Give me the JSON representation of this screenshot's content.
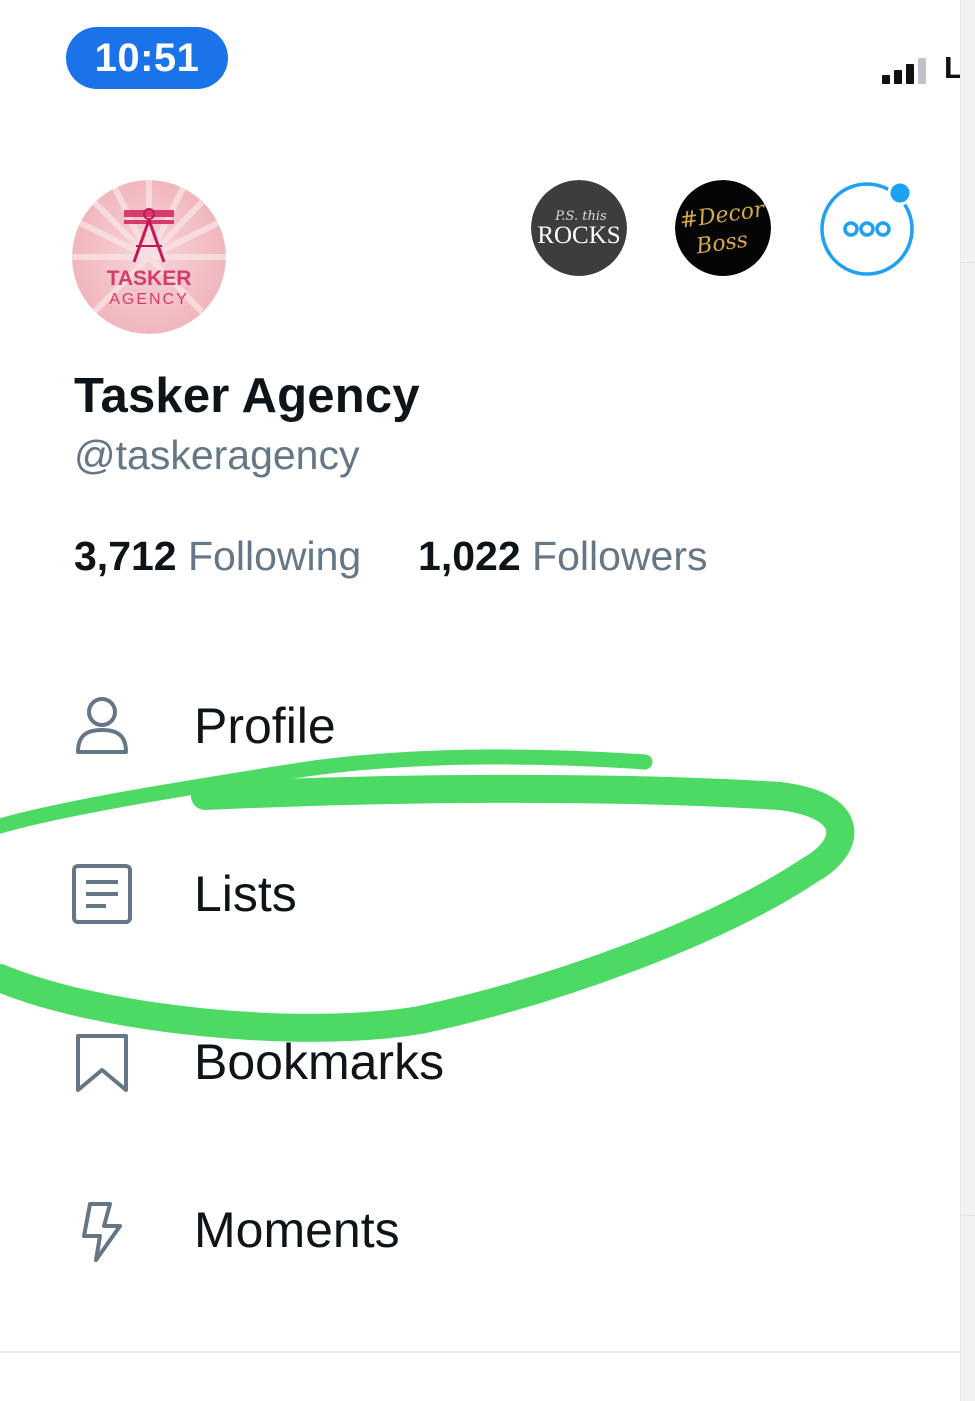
{
  "status_bar": {
    "time": "10:51",
    "carrier": "LT"
  },
  "colors": {
    "accent": "#1da1f2",
    "annotation": "#4cd964",
    "muted": "#657786"
  },
  "profile": {
    "avatar_text_top": "TASKER",
    "avatar_text_bottom": "AGENCY",
    "name": "Tasker Agency",
    "handle": "@taskeragency",
    "following_count": "3,712",
    "following_label": "Following",
    "followers_count": "1,022",
    "followers_label": "Followers"
  },
  "accounts": [
    {
      "line1": "P.S. this",
      "line2": "ROCKS"
    },
    {
      "line1": "#Decor",
      "line2": "Boss"
    }
  ],
  "more_icon": "more-dots-icon",
  "menu": [
    {
      "label": "Profile",
      "icon": "person-icon"
    },
    {
      "label": "Lists",
      "icon": "list-icon"
    },
    {
      "label": "Bookmarks",
      "icon": "bookmark-icon"
    },
    {
      "label": "Moments",
      "icon": "lightning-icon"
    }
  ]
}
